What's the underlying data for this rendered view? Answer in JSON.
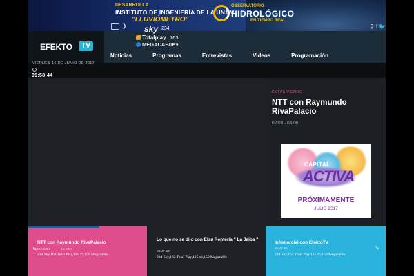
{
  "banner": {
    "line1": "DESARROLLA",
    "line2": "INSTITUTO DE INGENIERÍA DE LA UNAM",
    "line3": "\"LLUVIÓMETRO\"",
    "obs1": "OBSERVATORIO",
    "obs2": "HIDROLÓGICO",
    "obs3": "EN TIEMPO REAL"
  },
  "header": {
    "logo": "EFEKTO",
    "logo_badge": "TV",
    "sky_name": "sky",
    "sky_num": "234",
    "totalplay_name": "Totalplay",
    "totalplay_num": "163",
    "megacable_name": "MEGACABLE",
    "megacable_num": "159",
    "chevron": "❯",
    "social_search": "⚲",
    "social_fb": "f",
    "social_tw": "🐦"
  },
  "nav": [
    "Noticias",
    "Programas",
    "Entrevistas",
    "Videos",
    "Programación"
  ],
  "datebar": {
    "date": "VIERNES 16 DE JUNIO DE 2017",
    "time": "09:58:44"
  },
  "now_playing": {
    "label": "ESTÁS VIENDO",
    "title": "NTT con Raymundo RivaPalacio",
    "time": "02:00 - 04:00"
  },
  "promo": {
    "capital": "CAPITAL",
    "activa": "ACTIVA",
    "proximamente": "PRÓXIMAMENTE",
    "date": "JULIO 2017"
  },
  "cards": [
    {
      "title": "NTT con Raymundo RivaPalacio",
      "time": "02:00 hrs",
      "live": "En vivo",
      "channels": "234 Sky,163 Total Play,125 ▭,159 Megacable",
      "color": "#df4d8c"
    },
    {
      "title": "Lo que no se dijo con Elsa Rentería \" La Jaiba \"",
      "time": "04:00 hrs",
      "live": "",
      "channels": "234 Sky,163 Total Play,125 ▭,159 Megacable",
      "color": "#1e2226"
    },
    {
      "title": "Infomercial con EfektoTV",
      "time": "05:00 hrs",
      "live": "",
      "channels": "234 Sky,163 Total Play,125 ▭,159 Megacable",
      "color": "#2ab3dc"
    }
  ]
}
